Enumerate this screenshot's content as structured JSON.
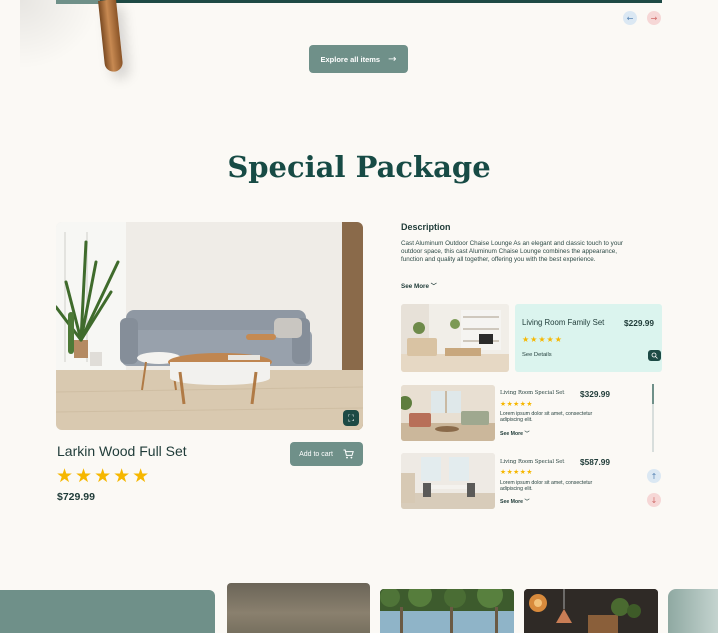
{
  "top": {
    "explore_label": "Explore all items",
    "arrow_icon": "→",
    "prev_icon": "←",
    "next_icon": "→"
  },
  "section": {
    "title": "Special Package"
  },
  "main_product": {
    "name": "Larkin Wood Full Set",
    "rating_stars": "★★★★★",
    "price": "$729.99",
    "add_to_cart": "Add to cart"
  },
  "description": {
    "heading": "Description",
    "text": "Cast Aluminum Outdoor Chaise Lounge As an elegant and classic touch to your outdoor space, this cast Aluminum Chaise Lounge combines the appearance, function and quality all together, offering you with the best experience.",
    "see_more": "See More"
  },
  "featured": {
    "name": "Living Room Family Set",
    "price": "$229.99",
    "rating_stars": "★★★★★",
    "details_label": "See Details"
  },
  "list": [
    {
      "name": "Living Room Special Set",
      "price": "$329.99",
      "rating_stars": "★★★★★",
      "text": "Lorem ipsum dolor sit amet, consectetur adipiscing elit.",
      "see_more": "See More"
    },
    {
      "name": "Living Room Special Set",
      "price": "$587.99",
      "rating_stars": "★★★★★",
      "text": "Lorem ipsum dolor sit amet, consectetur adipiscing elit.",
      "see_more": "See More"
    }
  ],
  "list_nav": {
    "up_icon": "↑",
    "down_icon": "↓"
  },
  "colors": {
    "accent": "#6f9089",
    "dark_teal": "#174b45",
    "star": "#f6b700",
    "mint": "#dbf4ee"
  }
}
